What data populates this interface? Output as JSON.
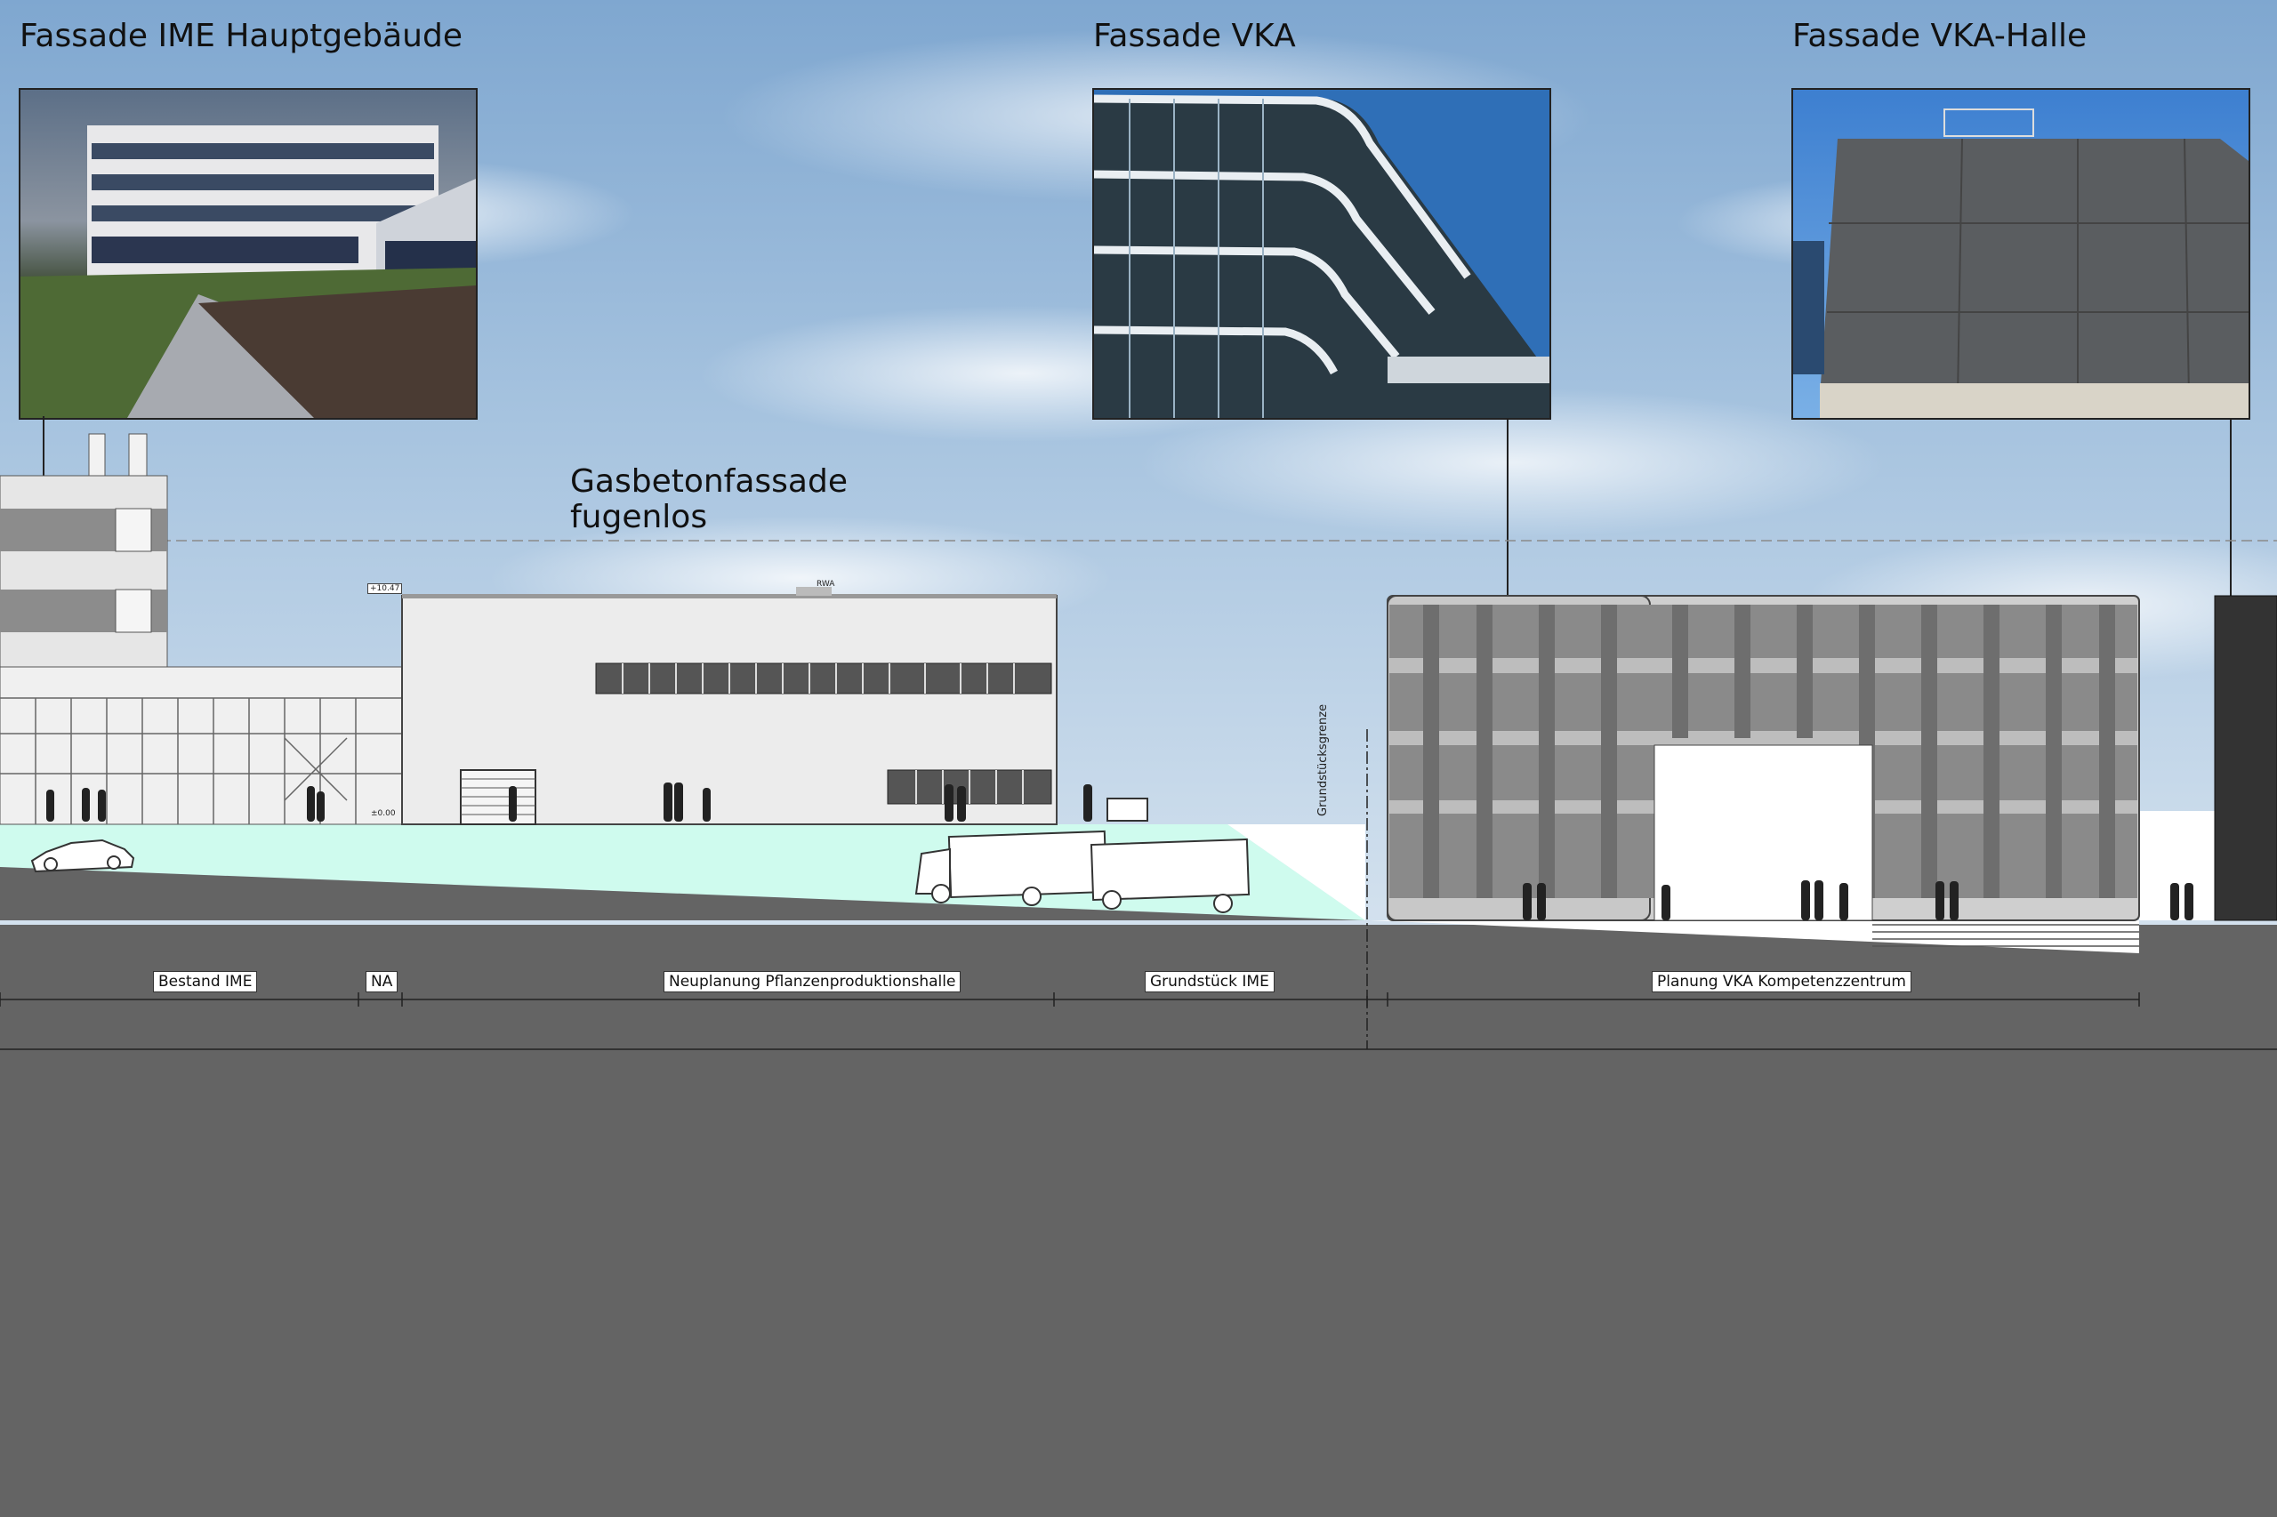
{
  "headings": {
    "ime_main": "Fassade IME Hauptgebäude",
    "vka": "Fassade VKA",
    "vka_halle": "Fassade VKA-Halle"
  },
  "annotation": {
    "line1": "Gasbetonfassade",
    "line2": "fugenlos"
  },
  "dimensions": {
    "bestand": "Bestand IME",
    "na": "NA",
    "neuplanung": "Neuplanung Pflanzenproduktionshalle",
    "grundstueck": "Grundstück IME",
    "planung_vka": "Planung VKA Kompetenzzentrum"
  },
  "grenze_label": "Grundstücksgrenze",
  "small_labels": {
    "rwa": "RWA",
    "level_top": "+10.47",
    "level_zero": "±0.00"
  },
  "colors": {
    "background": "#646464",
    "ground": "#cffbee",
    "building": "#ececec",
    "window": "#555555"
  }
}
